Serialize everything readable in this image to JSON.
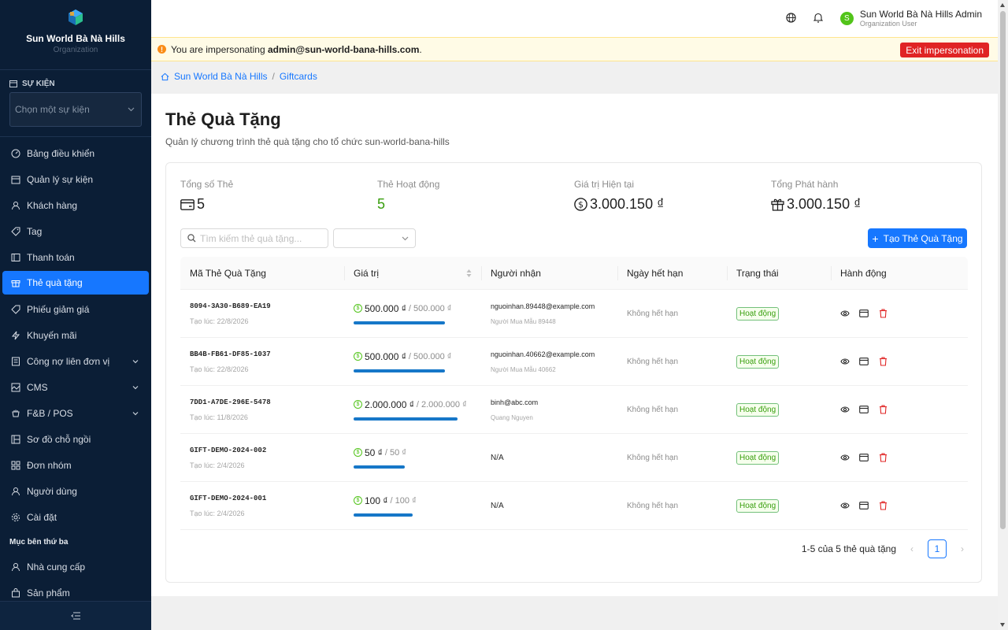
{
  "sidebar": {
    "brand_name": "Sun World Bà Nà Hills",
    "brand_sub": "Organization",
    "event_section_label": "SỰ KIỆN",
    "event_select_placeholder": "Chọn một sự kiện",
    "menu": [
      {
        "label": "Bảng điều khiển",
        "icon": "dashboard-icon"
      },
      {
        "label": "Quản lý sự kiện",
        "icon": "calendar-icon"
      },
      {
        "label": "Khách hàng",
        "icon": "user-icon"
      },
      {
        "label": "Tag",
        "icon": "tag-icon"
      },
      {
        "label": "Thanh toán",
        "icon": "payment-icon"
      },
      {
        "label": "Thẻ quà tặng",
        "icon": "gift-icon",
        "active": true
      },
      {
        "label": "Phiếu giảm giá",
        "icon": "coupon-icon"
      },
      {
        "label": "Khuyến mãi",
        "icon": "lightning-icon"
      },
      {
        "label": "Công nợ liên đơn vị",
        "icon": "ledger-icon",
        "expandable": true
      },
      {
        "label": "CMS",
        "icon": "cms-icon",
        "expandable": true
      },
      {
        "label": "F&B / POS",
        "icon": "fnb-icon",
        "expandable": true
      },
      {
        "label": "Sơ đồ chỗ ngồi",
        "icon": "seatmap-icon"
      },
      {
        "label": "Đơn nhóm",
        "icon": "grid-icon"
      },
      {
        "label": "Người dùng",
        "icon": "user-icon"
      },
      {
        "label": "Cài đặt",
        "icon": "gear-icon"
      }
    ],
    "third_party_label": "Mục bên thứ ba",
    "third_party_menu": [
      {
        "label": "Nhà cung cấp",
        "icon": "user-icon"
      },
      {
        "label": "Sản phẩm",
        "icon": "bag-icon"
      }
    ]
  },
  "header": {
    "user_initial": "S",
    "user_name": "Sun World Bà Nà Hills Admin",
    "user_role": "Organization User"
  },
  "impersonation": {
    "prefix": "You are impersonating",
    "email": "admin@sun-world-bana-hills.com",
    "suffix": ".",
    "exit_label": "Exit impersonation"
  },
  "breadcrumb": {
    "home": "Sun World Bà Nà Hills",
    "separator": "/",
    "current": "Giftcards"
  },
  "page": {
    "title": "Thẻ Quà Tặng",
    "subtitle": "Quản lý chương trình thẻ quà tặng cho tổ chức sun-world-bana-hills"
  },
  "stats": [
    {
      "label": "Tổng số Thẻ",
      "value": "5",
      "icon": "card-icon"
    },
    {
      "label": "Thẻ Hoạt động",
      "value": "5",
      "icon": ""
    },
    {
      "label": "Giá trị Hiện tại",
      "value": "3.000.150 ₫",
      "icon": "dollar-icon"
    },
    {
      "label": "Tổng Phát hành",
      "value": "3.000.150 ₫",
      "icon": "gift-icon"
    }
  ],
  "toolbar": {
    "search_placeholder": "Tìm kiếm thẻ quà tặng...",
    "create_label": "Tạo Thẻ Quà Tặng"
  },
  "table": {
    "headers": [
      "Mã Thẻ Quà Tặng",
      "Giá trị",
      "Người nhận",
      "Ngày hết hạn",
      "Trạng thái",
      "Hành động"
    ],
    "rows": [
      {
        "code": "8094-3A30-B689-EA19",
        "created": "Tạo lúc: 22/8/2026",
        "value": "500.000 ₫",
        "total": "/ 500.000 ₫",
        "balance_ratio": 1.0,
        "email": "nguoinhan.89448@example.com",
        "buyer": "Người Mua Mẫu 89448",
        "expiry": "Không hết hạn",
        "status": "Hoạt động"
      },
      {
        "code": "BB4B-FB61-DF85-1037",
        "created": "Tạo lúc: 22/8/2026",
        "value": "500.000 ₫",
        "total": "/ 500.000 ₫",
        "balance_ratio": 1.0,
        "email": "nguoinhan.40662@example.com",
        "buyer": "Người Mua Mẫu 40662",
        "expiry": "Không hết hạn",
        "status": "Hoạt động"
      },
      {
        "code": "7DD1-A7DE-296E-5478",
        "created": "Tạo lúc: 11/8/2026",
        "value": "2.000.000 ₫",
        "total": "/ 2.000.000 ₫",
        "balance_ratio": 1.0,
        "email": "binh@abc.com",
        "buyer": "Quang Nguyen",
        "expiry": "Không hết hạn",
        "status": "Hoạt động"
      },
      {
        "code": "GIFT-DEMO-2024-002",
        "created": "Tạo lúc: 2/4/2026",
        "value": "50 ₫",
        "total": "/ 50 ₫",
        "balance_ratio": 1.0,
        "email": "N/A",
        "buyer": "",
        "expiry": "Không hết hạn",
        "status": "Hoạt động"
      },
      {
        "code": "GIFT-DEMO-2024-001",
        "created": "Tạo lúc: 2/4/2026",
        "value": "100 ₫",
        "total": "/ 100 ₫",
        "balance_ratio": 1.0,
        "email": "N/A",
        "buyer": "",
        "expiry": "Không hết hạn",
        "status": "Hoạt động"
      }
    ]
  },
  "pagination": {
    "summary": "1-5 của 5 thẻ quà tặng",
    "current_page": "1"
  },
  "colors": {
    "sidebar_bg": "#0b1e36",
    "accent": "#1677ff",
    "success": "#389e0d",
    "danger": "#e02424"
  }
}
